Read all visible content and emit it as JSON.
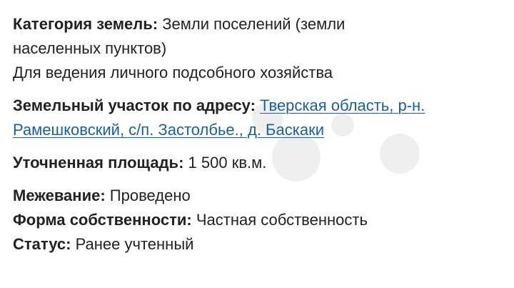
{
  "land_category": {
    "label": "Категория земель:",
    "value_line1": "Земли поселений (земли",
    "value_line2": "населенных пунктов)",
    "usage": "Для ведения личного подсобного хозяйства"
  },
  "address": {
    "label": "Земельный участок по адресу:",
    "link_line1": "Тверская область, р-н.",
    "link_line2": "Рамешковский, с/п. Застолбье., д. Баскаки"
  },
  "area": {
    "label": "Уточненная площадь:",
    "value": "1 500 кв.м."
  },
  "survey": {
    "label": "Межевание:",
    "value": "Проведено"
  },
  "ownership": {
    "label": "Форма собственности:",
    "value": "Частная собственность"
  },
  "status": {
    "label": "Статус:",
    "value": "Ранее учтенный"
  },
  "colors": {
    "text": "#222222",
    "link": "#1a5fa8",
    "background": "#ffffff"
  },
  "watermark_icon": "avito-logo-watermark"
}
